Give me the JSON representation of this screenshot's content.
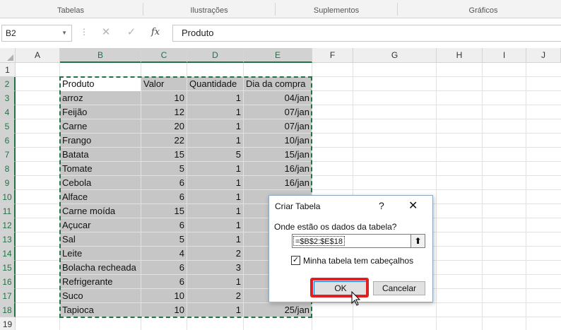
{
  "ribbon": {
    "groups": [
      "Tabelas",
      "Ilustrações",
      "Suplementos",
      "Gráficos"
    ]
  },
  "formula_bar": {
    "name_box": "B2",
    "content": "Produto",
    "fx_label": "fx"
  },
  "sheet": {
    "columns": [
      "A",
      "B",
      "C",
      "D",
      "E",
      "F",
      "G",
      "H",
      "I",
      "J"
    ],
    "rows": [
      "1",
      "2",
      "3",
      "4",
      "5",
      "6",
      "7",
      "8",
      "9",
      "10",
      "11",
      "12",
      "13",
      "14",
      "15",
      "16",
      "17",
      "18",
      "19"
    ],
    "headers": [
      "Produto",
      "Valor",
      "Quantidade",
      "Dia da compra"
    ],
    "data": [
      [
        "arroz",
        "10",
        "1",
        "04/jan"
      ],
      [
        "Feijão",
        "12",
        "1",
        "07/jan"
      ],
      [
        "Carne",
        "20",
        "1",
        "07/jan"
      ],
      [
        "Frango",
        "22",
        "1",
        "10/jan"
      ],
      [
        "Batata",
        "15",
        "5",
        "15/jan"
      ],
      [
        "Tomate",
        "5",
        "1",
        "16/jan"
      ],
      [
        "Cebola",
        "6",
        "1",
        "16/jan"
      ],
      [
        "Alface",
        "6",
        "1",
        ""
      ],
      [
        "Carne moída",
        "15",
        "1",
        ""
      ],
      [
        "Açucar",
        "6",
        "1",
        ""
      ],
      [
        "Sal",
        "5",
        "1",
        ""
      ],
      [
        "Leite",
        "4",
        "2",
        ""
      ],
      [
        "Bolacha recheada",
        "6",
        "3",
        ""
      ],
      [
        "Refrigerante",
        "6",
        "1",
        ""
      ],
      [
        "Suco",
        "10",
        "2",
        ""
      ],
      [
        "Tapioca",
        "10",
        "1",
        "25/jan"
      ]
    ]
  },
  "dialog": {
    "title": "Criar Tabela",
    "help": "?",
    "close": "✕",
    "prompt": "Onde estão os dados da tabela?",
    "range_value": "=$B$2:$E$18",
    "collapse_icon": "⬆",
    "checkbox_checked": true,
    "checkbox_label": "Minha tabela tem cabeçalhos",
    "ok_label": "OK",
    "cancel_label": "Cancelar"
  },
  "colors": {
    "accent": "#217346",
    "highlight": "#e02020"
  }
}
